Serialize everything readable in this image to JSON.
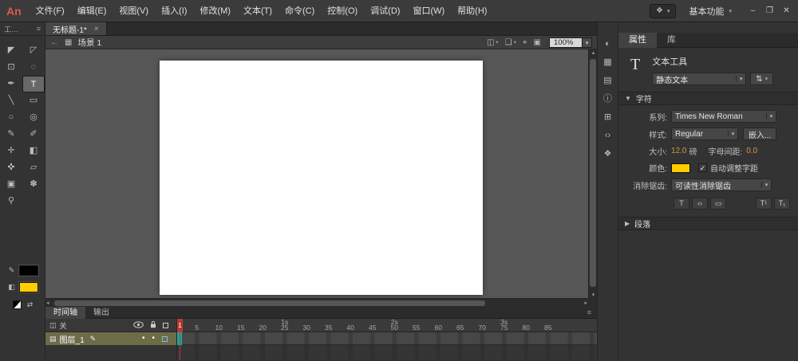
{
  "colors": {
    "accent_yellow": "#FFCC00",
    "playhead_red": "#b8392e",
    "keyframe_teal": "#1aa6a0",
    "value_amber": "#d2993f",
    "logo_red": "#e2574a"
  },
  "titlebar": {
    "logo": "An",
    "menus": [
      {
        "id": "file",
        "label": "文件(F)"
      },
      {
        "id": "edit",
        "label": "编辑(E)"
      },
      {
        "id": "view",
        "label": "视图(V)"
      },
      {
        "id": "insert",
        "label": "插入(I)"
      },
      {
        "id": "modify",
        "label": "修改(M)"
      },
      {
        "id": "text",
        "label": "文本(T)"
      },
      {
        "id": "commands",
        "label": "命令(C)"
      },
      {
        "id": "control",
        "label": "控制(O)"
      },
      {
        "id": "debug",
        "label": "调试(D)"
      },
      {
        "id": "window",
        "label": "窗口(W)"
      },
      {
        "id": "help",
        "label": "帮助(H)"
      }
    ],
    "utility": {
      "icon_a": "❖",
      "icon_b": "▾"
    },
    "workspace_label": "基本功能",
    "workspace_caret": "▾",
    "window": {
      "minimize": "–",
      "restore": "❐",
      "close": "✕"
    }
  },
  "tools_panel": {
    "header_label": "工…",
    "panel_menu_icon": "≡",
    "tools": [
      {
        "name": "selection-tool",
        "glyph": "◤"
      },
      {
        "name": "subselection-tool",
        "glyph": "◸"
      },
      {
        "name": "free-transform-tool",
        "glyph": "⊡"
      },
      {
        "name": "lasso-tool",
        "glyph": "◌"
      },
      {
        "name": "pen-tool",
        "glyph": "✒"
      },
      {
        "name": "text-tool",
        "glyph": "T",
        "selected": true
      },
      {
        "name": "line-tool",
        "glyph": "╲"
      },
      {
        "name": "rectangle-tool",
        "glyph": "▭"
      },
      {
        "name": "oval-tool",
        "glyph": "○"
      },
      {
        "name": "oval-primitive-tool",
        "glyph": "◎"
      },
      {
        "name": "pencil-tool",
        "glyph": "✎"
      },
      {
        "name": "brush-tool",
        "glyph": "✐"
      },
      {
        "name": "bone-tool",
        "glyph": "✛"
      },
      {
        "name": "paint-bucket-tool",
        "glyph": "◧"
      },
      {
        "name": "eyedropper-tool",
        "glyph": "✜"
      },
      {
        "name": "eraser-tool",
        "glyph": "▱"
      },
      {
        "name": "camera-tool",
        "glyph": "▣"
      },
      {
        "name": "hand-tool",
        "glyph": "✽"
      },
      {
        "name": "zoom-tool",
        "glyph": "⚲"
      }
    ],
    "stroke_icon": "✎",
    "fill_icon": "◧",
    "stroke_color": "#000000",
    "fill_color": "#FFCC00",
    "swap_icon": "⇄"
  },
  "document": {
    "tab_title": "无标题-1*",
    "close_icon": "×"
  },
  "stage": {
    "back_icon": "←",
    "scene_icon": "▦",
    "scene_label": "场景 1",
    "edit_scene_icon": "◫",
    "edit_symbols_icon": "❏",
    "center_frame_icon": "⌖",
    "clip_icon": "▣",
    "zoom_value": "100%",
    "zoom_caret": "▾"
  },
  "scrollbars": {
    "up": "▴",
    "down": "▾",
    "left": "◂",
    "right": "▸"
  },
  "dock": {
    "icons": [
      {
        "name": "color-panel-icon",
        "glyph": "◐"
      },
      {
        "name": "swatches-panel-icon",
        "glyph": "▦"
      },
      {
        "name": "align-panel-icon",
        "glyph": "▤"
      },
      {
        "name": "info-panel-icon",
        "glyph": "ⓘ"
      },
      {
        "name": "transform-panel-icon",
        "glyph": "⊞"
      },
      {
        "name": "code-snippets-panel-icon",
        "glyph": "‹›"
      },
      {
        "name": "components-panel-icon",
        "glyph": "❖"
      }
    ]
  },
  "properties": {
    "caret": "▾",
    "tabs": [
      {
        "label": "属性",
        "active": true
      },
      {
        "label": "库",
        "active": false
      }
    ],
    "tool_glyph": "T",
    "tool_name": "文本工具",
    "text_type_value": "静态文本",
    "direction_icon": "⇅",
    "character": {
      "title": "字符",
      "collapse_icon": "▼",
      "family_label": "系列:",
      "family_value": "Times New Roman",
      "style_label": "样式:",
      "style_value": "Regular",
      "embed_label": "嵌入...",
      "size_label": "大小:",
      "size_value": "12.0",
      "size_unit": "磅",
      "spacing_label": "字母间距:",
      "spacing_value": "0.0",
      "color_label": "颜色:",
      "color_value": "#FFCC00",
      "autokern_check": "✓",
      "autokern_label": "自动调整字距",
      "antialias_label": "消除锯齿:",
      "antialias_value": "可读性消除锯齿",
      "toggles_left": [
        {
          "name": "selectable-toggle",
          "glyph": "T"
        },
        {
          "name": "render-html-toggle",
          "glyph": "‹›"
        },
        {
          "name": "show-border-toggle",
          "glyph": "▭"
        }
      ],
      "toggles_right": [
        {
          "name": "superscript-toggle",
          "glyph": "T¹"
        },
        {
          "name": "subscript-toggle",
          "glyph": "T₁"
        }
      ]
    },
    "paragraph": {
      "title": "段落",
      "collapse_icon": "▶"
    }
  },
  "timeline": {
    "tabs": [
      {
        "label": "时间轴",
        "active": true
      },
      {
        "label": "输出",
        "active": false
      }
    ],
    "panel_menu_icon": "≡",
    "header": {
      "depth_icon": "◫",
      "depth_label": "关"
    },
    "layer": {
      "icon": "▤",
      "name": "图层_1",
      "edit_icon": "✎",
      "visible_dot": "•",
      "lock_dot": "•"
    },
    "ruler": {
      "current_frame": "1",
      "frame_labels": [
        "5",
        "10",
        "15",
        "20",
        "25",
        "30",
        "35",
        "40",
        "45",
        "50",
        "55",
        "60",
        "65",
        "70",
        "75",
        "80",
        "85"
      ],
      "second_labels": [
        {
          "text": "1s",
          "frame": 25
        },
        {
          "text": "2s",
          "frame": 50
        },
        {
          "text": "3s",
          "frame": 75
        }
      ]
    }
  }
}
